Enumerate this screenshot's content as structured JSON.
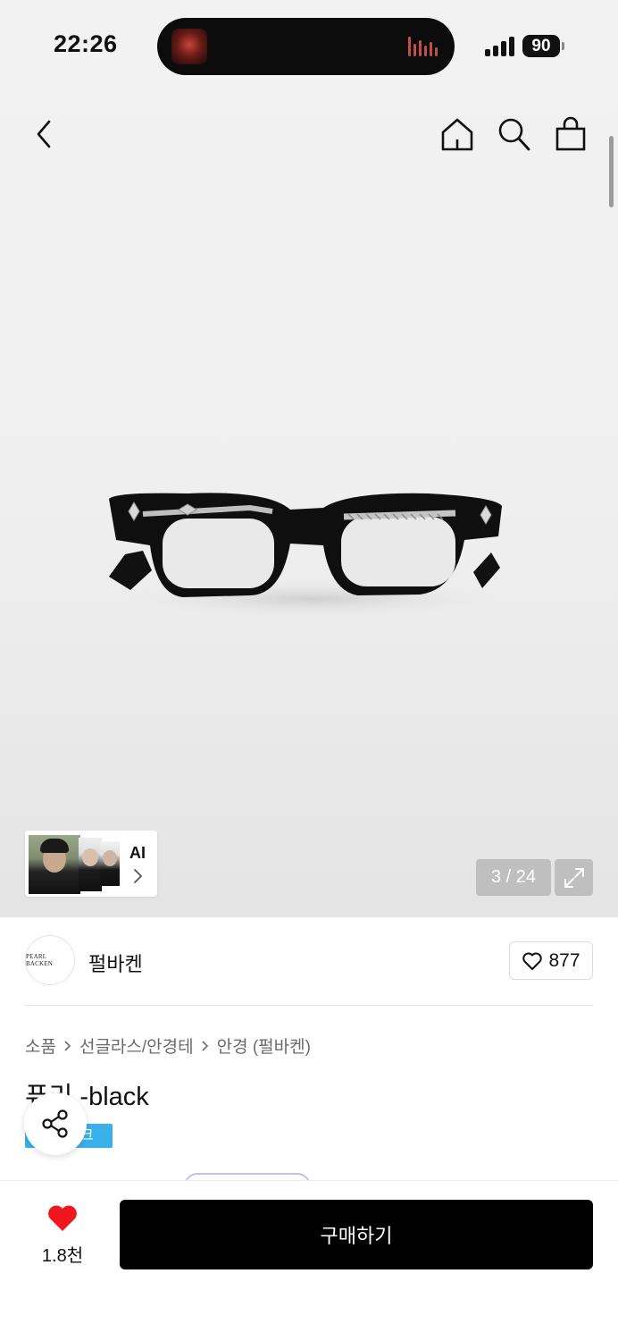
{
  "status_bar": {
    "time": "22:26",
    "battery": "90"
  },
  "gallery": {
    "counter": "3 / 24",
    "ai_label": "AI"
  },
  "brand": {
    "logo_text": "PEARL BACKEN",
    "name": "펄바켄",
    "like_count": "877"
  },
  "breadcrumb": [
    "소품",
    "선글라스/안경테",
    "안경 (펄바켄)"
  ],
  "product": {
    "title": "퓨리 -black",
    "tag": "크",
    "tag_color": "#3ab0ea"
  },
  "bottom_bar": {
    "wish_count": "1.8천",
    "buy_label": "구매하기",
    "heart_color": "#f0161e"
  },
  "icons": [
    "back-icon",
    "home-icon",
    "search-icon",
    "bag-icon",
    "chevron-right-icon",
    "expand-icon",
    "heart-outline-icon",
    "share-icon",
    "heart-filled-icon"
  ]
}
